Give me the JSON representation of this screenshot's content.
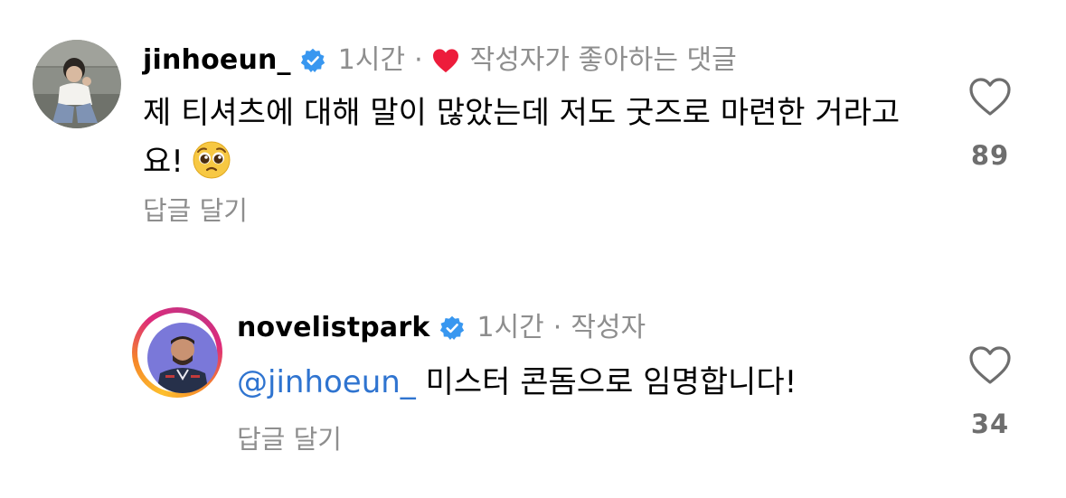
{
  "comments": [
    {
      "username": "jinhoeun_",
      "verified": true,
      "time": "1시간",
      "separator": "·",
      "meta_label": "작성자가 좋아하는 댓글",
      "text": "제 티셔츠에 대해 말이 많았는데 저도 굿즈로 마련한 거라고요!",
      "emoji": "pleading-face",
      "reply_label": "답글 달기",
      "like_count": "89"
    },
    {
      "username": "novelistpark",
      "verified": true,
      "time": "1시간",
      "separator": "·",
      "meta_label": "작성자",
      "mention": "@jinhoeun_",
      "text": "미스터 콘돔으로 임명합니다!",
      "reply_label": "답글 달기",
      "like_count": "34",
      "story_ring": true
    }
  ],
  "colors": {
    "verified_badge": "#3897f0",
    "liked_heart": "#ed1c3b",
    "mention": "#2f74d0",
    "meta_gray": "#8e8e8e"
  },
  "icons": {
    "verified": "verified-badge-icon",
    "liked_by_author": "heart-filled-icon",
    "like": "heart-outline-icon"
  }
}
